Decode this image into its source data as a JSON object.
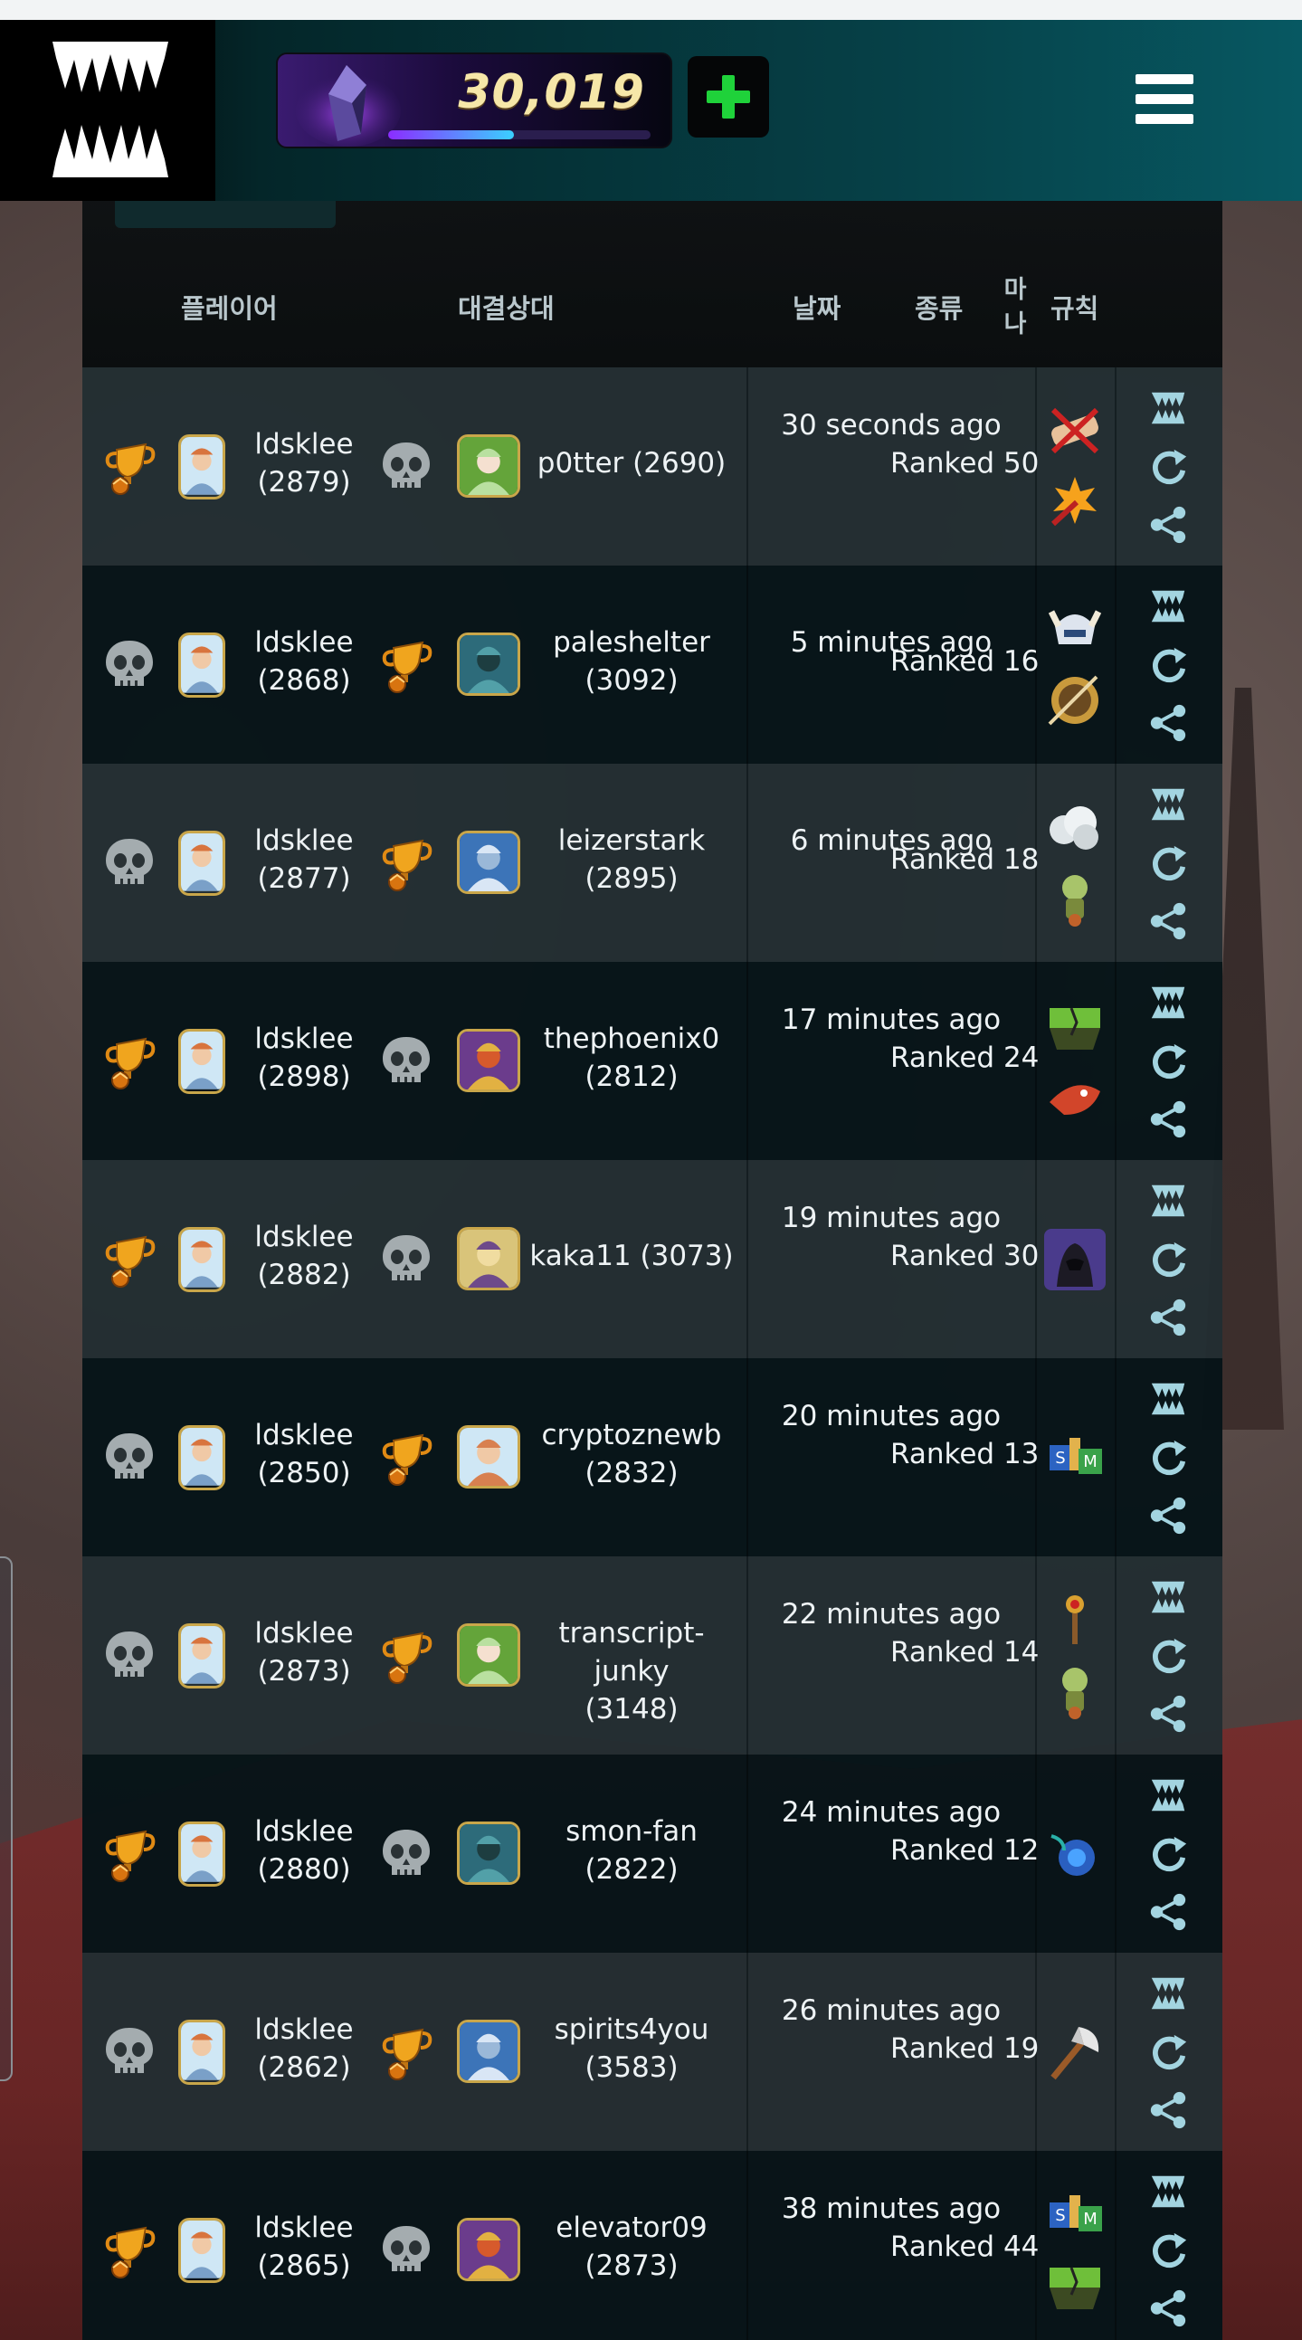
{
  "header": {
    "dec_amount": "30,019",
    "dec_progress": 0.48,
    "logo_icon": "splinterlands-fangs-logo",
    "buy_icon": "plus-icon",
    "menu_icon": "hamburger-menu-icon"
  },
  "columns": {
    "player": "플레이어",
    "opponent": "대결상대",
    "date": "날짜",
    "type": "종류",
    "mana": "마나",
    "rules": "규칙"
  },
  "rows": [
    {
      "player_result": "win",
      "player_name": "ldsklee",
      "player_rating": "(2879)",
      "opponent_result": "loss",
      "opponent_name": "p0tter",
      "opponent_rating": "(2690)",
      "opponent_line": "p0tter (2690)",
      "date": "30 seconds ago",
      "type": "Ranked",
      "mana": "50",
      "type_mana": "Ranked 50",
      "rules": [
        "healed-out-rule-icon",
        "explosive-weaponry-rule-icon"
      ]
    },
    {
      "player_result": "loss",
      "player_name": "ldsklee",
      "player_rating": "(2868)",
      "opponent_result": "win",
      "opponent_name": "paleshelter",
      "opponent_rating": "(3092)",
      "date": "5 minutes ago",
      "type": "Ranked",
      "mana": "16",
      "type_mana": "Ranked 16",
      "rules": [
        "heavy-hitters-rule-icon",
        "aim-true-rule-icon"
      ]
    },
    {
      "player_result": "loss",
      "player_name": "ldsklee",
      "player_rating": "(2877)",
      "opponent_result": "win",
      "opponent_name": "leizerstark",
      "opponent_rating": "(2895)",
      "date": "6 minutes ago",
      "type": "Ranked",
      "mana": "18",
      "type_mana": "Ranked 18",
      "rules": [
        "fog-of-war-rule-icon",
        "little-league-rule-icon"
      ]
    },
    {
      "player_result": "win",
      "player_name": "ldsklee",
      "player_rating": "(2898)",
      "opponent_result": "loss",
      "opponent_name": "thephoenix0",
      "opponent_rating": "(2812)",
      "date": "17 minutes ago",
      "type": "Ranked",
      "mana": "24",
      "type_mana": "Ranked 24",
      "rules": [
        "earthquake-rule-icon",
        "fire-and-regret-rule-icon"
      ]
    },
    {
      "player_result": "win",
      "player_name": "ldsklee",
      "player_rating": "(2882)",
      "opponent_result": "loss",
      "opponent_name": "kaka11",
      "opponent_rating": "(3073)",
      "opponent_line": "kaka11 (3073)",
      "date": "19 minutes ago",
      "type": "Ranked",
      "mana": "30",
      "type_mana": "Ranked 30",
      "rules": [
        "standard-hooded-rule-icon"
      ]
    },
    {
      "player_result": "loss",
      "player_name": "ldsklee",
      "player_rating": "(2850)",
      "opponent_result": "win",
      "opponent_name": "cryptoznewb",
      "opponent_rating": "(2832)",
      "date": "20 minutes ago",
      "type": "Ranked",
      "mana": "13",
      "type_mana": "Ranked 13",
      "rules": [
        "keep-your-distance-blocks-rule-icon"
      ]
    },
    {
      "player_result": "loss",
      "player_name": "ldsklee",
      "player_rating": "(2873)",
      "opponent_result": "win",
      "opponent_name": "transcript-junky",
      "opponent_rating": "(3148)",
      "date": "22 minutes ago",
      "type": "Ranked",
      "mana": "14",
      "type_mana": "Ranked 14",
      "rules": [
        "target-practice-rule-icon",
        "little-league-rule-icon"
      ]
    },
    {
      "player_result": "win",
      "player_name": "ldsklee",
      "player_rating": "(2880)",
      "opponent_result": "loss",
      "opponent_name": "smon-fan",
      "opponent_rating": "(2822)",
      "date": "24 minutes ago",
      "type": "Ranked",
      "mana": "12",
      "type_mana": "Ranked 12",
      "rules": [
        "counterspell-rule-icon"
      ]
    },
    {
      "player_result": "loss",
      "player_name": "ldsklee",
      "player_rating": "(2862)",
      "opponent_result": "win",
      "opponent_name": "spirits4you",
      "opponent_rating": "(3583)",
      "date": "26 minutes ago",
      "type": "Ranked",
      "mana": "19",
      "type_mana": "Ranked 19",
      "rules": [
        "armored-up-axe-rule-icon"
      ]
    },
    {
      "player_result": "win",
      "player_name": "ldsklee",
      "player_rating": "(2865)",
      "opponent_result": "loss",
      "opponent_name": "elevator09",
      "opponent_rating": "(2873)",
      "date": "38 minutes ago",
      "type": "Ranked",
      "mana": "44",
      "type_mana": "Ranked 44",
      "rules": [
        "keep-your-distance-blocks-rule-icon",
        "earthquake-rule-icon"
      ]
    }
  ],
  "row_actions": [
    "battle-replay-icon",
    "rematch-refresh-icon",
    "share-icon"
  ],
  "colors": {
    "header_teal": "#075862",
    "row_odd": "#222e32",
    "row_even": "#061418",
    "trophy": "#e39a1c",
    "skull": "#9aa3a6",
    "action_icon": "#9fd3e0"
  }
}
